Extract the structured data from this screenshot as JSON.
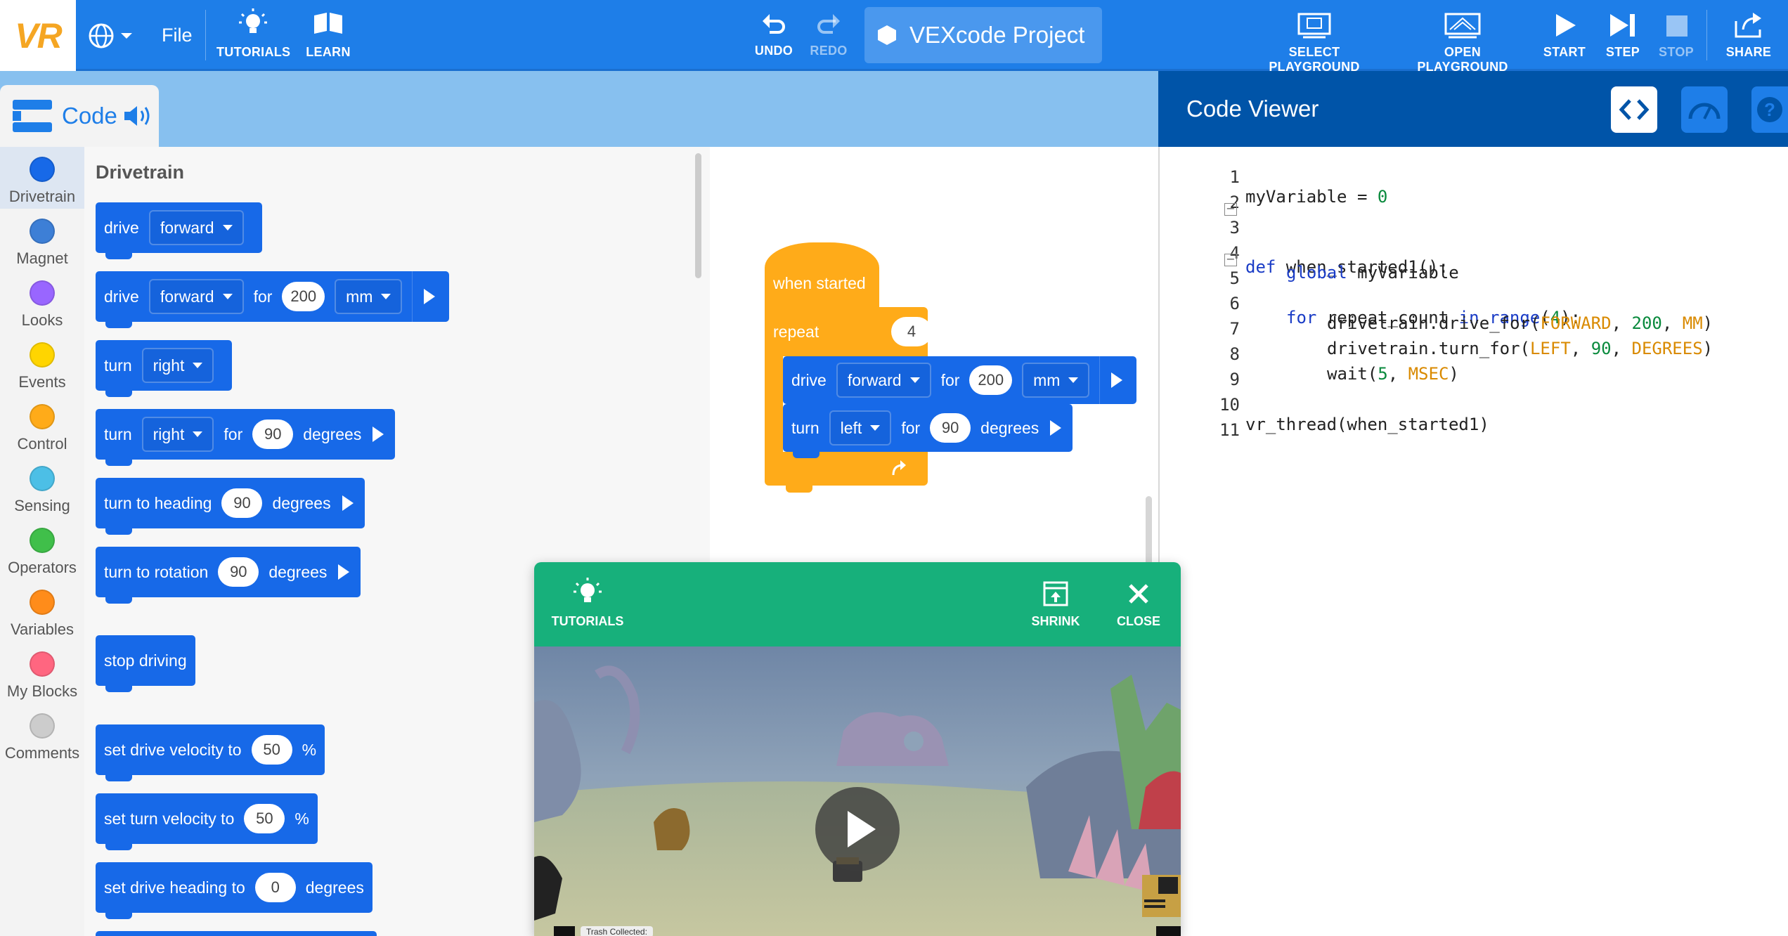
{
  "topbar": {
    "logo": "VR",
    "file_label": "File",
    "tutorials_label": "TUTORIALS",
    "learn_label": "LEARN",
    "undo_label": "UNDO",
    "redo_label": "REDO",
    "project_name": "VEXcode Project",
    "select_playground_label": "SELECT PLAYGROUND",
    "open_playground_label": "OPEN PLAYGROUND",
    "start_label": "START",
    "step_label": "STEP",
    "stop_label": "STOP",
    "share_label": "SHARE",
    "icons": [
      "globe-icon",
      "lightbulb-icon",
      "book-icon",
      "undo-icon",
      "redo-icon",
      "hexagon-icon",
      "monitor-icon",
      "playground-icon",
      "play-icon",
      "step-icon",
      "stop-icon",
      "share-icon"
    ]
  },
  "code_tab": {
    "label": "Code",
    "icons": [
      "blocks-icon",
      "speaker-icon"
    ]
  },
  "categories": [
    {
      "label": "Drivetrain",
      "color": "#1769e8"
    },
    {
      "label": "Magnet",
      "color": "#3d7fd6"
    },
    {
      "label": "Looks",
      "color": "#9966ff"
    },
    {
      "label": "Events",
      "color": "#ffd500"
    },
    {
      "label": "Control",
      "color": "#ffab19"
    },
    {
      "label": "Sensing",
      "color": "#4cbfe6"
    },
    {
      "label": "Operators",
      "color": "#40bf4a"
    },
    {
      "label": "Variables",
      "color": "#ff8c1a"
    },
    {
      "label": "My Blocks",
      "color": "#ff6680"
    },
    {
      "label": "Comments",
      "color": "#cccccc"
    }
  ],
  "palette": {
    "title": "Drivetrain",
    "drive": "drive",
    "forward": "forward",
    "for": "for",
    "mm": "mm",
    "turn": "turn",
    "right": "right",
    "degrees": "degrees",
    "turn_to_heading": "turn to heading",
    "turn_to_rotation": "turn to rotation",
    "stop_driving": "stop driving",
    "set_drive_velocity": "set drive velocity to",
    "set_turn_velocity": "set turn velocity to",
    "set_drive_heading": "set drive heading to",
    "percent": "%",
    "v200": "200",
    "v90": "90",
    "v50": "50",
    "v0": "0"
  },
  "workspace": {
    "when_started": "when started",
    "repeat": "repeat",
    "repeat_count": "4",
    "drive": "drive",
    "forward": "forward",
    "for": "for",
    "distance": "200",
    "mm": "mm",
    "turn": "turn",
    "left": "left",
    "angle": "90",
    "degrees": "degrees"
  },
  "code_viewer": {
    "title": "Code Viewer",
    "icons": [
      "code-brackets-icon",
      "dashboard-icon",
      "help-icon"
    ],
    "lines": [
      {
        "n": "1"
      },
      {
        "n": "2"
      },
      {
        "n": "3"
      },
      {
        "n": "4"
      },
      {
        "n": "5"
      },
      {
        "n": "6"
      },
      {
        "n": "7"
      },
      {
        "n": "8"
      },
      {
        "n": "9"
      },
      {
        "n": "10"
      },
      {
        "n": "11"
      }
    ],
    "code": {
      "l1_var": "myVariable = ",
      "l1_num": "0",
      "l3_def": "def",
      "l3_name": " when_started1():",
      "l4_kw": "global",
      "l4_rest": " myVariable",
      "l5_for": "for",
      "l5_mid": " repeat_count ",
      "l5_in": "in",
      "l5_range": " range",
      "l5_open": "(",
      "l5_num": "4",
      "l5_close": "):",
      "l6_call": "drivetrain.drive_for(",
      "l6_c1": "FORWARD",
      "l6_sep1": ", ",
      "l6_n": "200",
      "l6_sep2": ", ",
      "l6_c2": "MM",
      "l6_end": ")",
      "l7_call": "drivetrain.turn_for(",
      "l7_c1": "LEFT",
      "l7_sep1": ", ",
      "l7_n": "90",
      "l7_sep2": ", ",
      "l7_c2": "DEGREES",
      "l7_end": ")",
      "l8_call": "wait(",
      "l8_n": "5",
      "l8_sep": ", ",
      "l8_c": "MSEC",
      "l8_end": ")",
      "l10": "vr_thread(when_started1)"
    }
  },
  "tutorial_popup": {
    "tutorials_label": "TUTORIALS",
    "shrink_label": "SHRINK",
    "close_label": "CLOSE",
    "trash_label": "Trash Collected:"
  }
}
